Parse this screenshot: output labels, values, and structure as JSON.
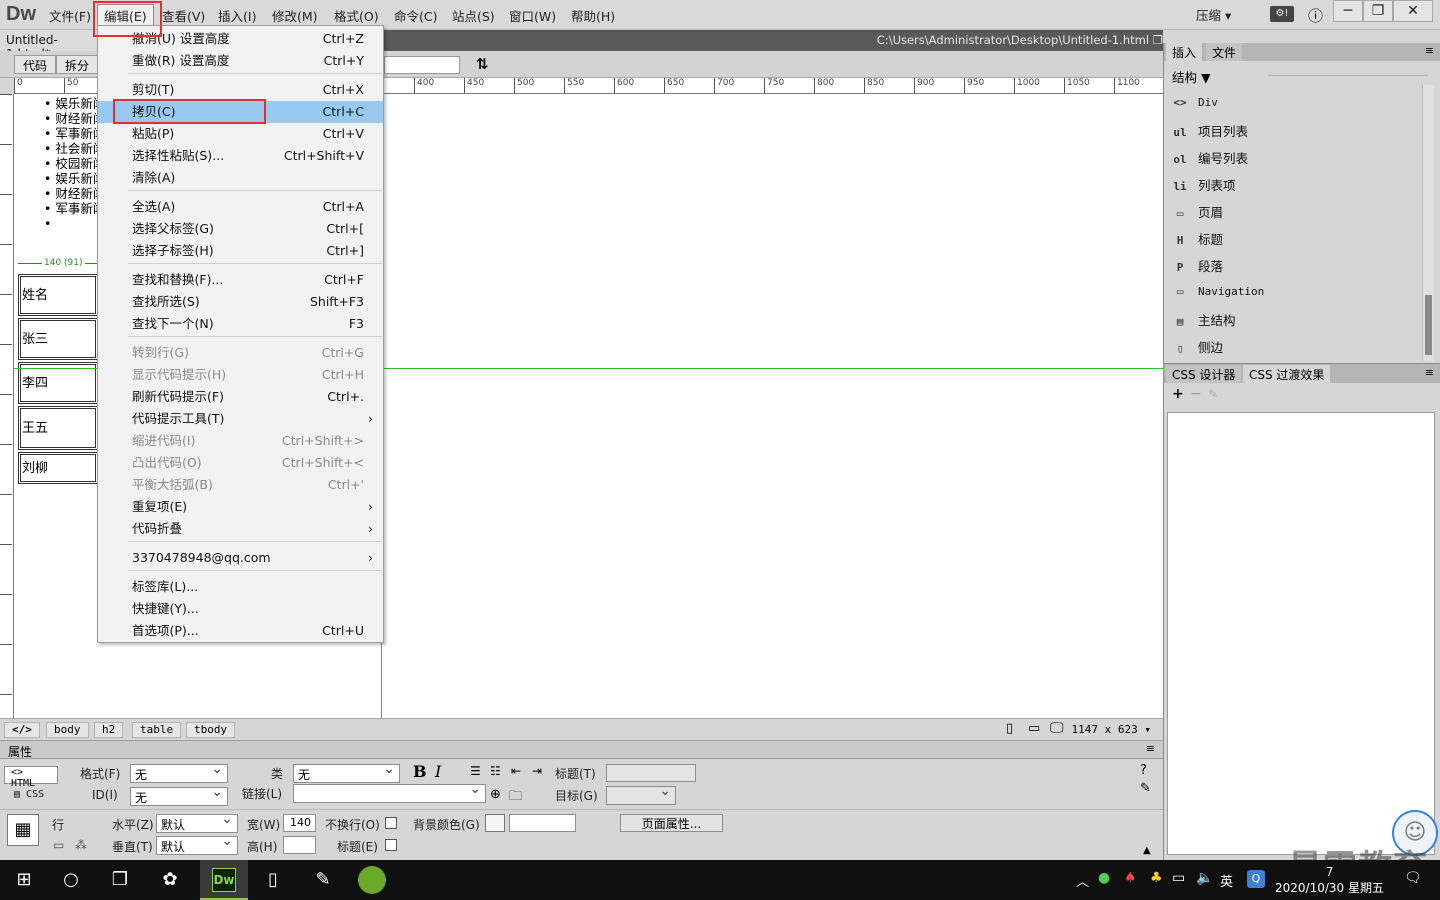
{
  "app": {
    "logo": "Dw",
    "doc_tab": "Untitled-1.html*",
    "doc_path": "C:\\Users\\Administrator\\Desktop\\Untitled-1.html",
    "compress": "压缩",
    "active_menu_color": "#e03030"
  },
  "menubar": {
    "items": [
      "文件(F)",
      "编辑(E)",
      "查看(V)",
      "插入(I)",
      "修改(M)",
      "格式(O)",
      "命令(C)",
      "站点(S)",
      "窗口(W)",
      "帮助(H)"
    ]
  },
  "toolbar": {
    "code": "代码",
    "split": "拆分"
  },
  "ruler": {
    "h": [
      "0",
      "50",
      "400",
      "450",
      "500",
      "550",
      "600",
      "650",
      "700",
      "750",
      "800",
      "850",
      "900",
      "950",
      "1000",
      "1050",
      "1100"
    ]
  },
  "content": {
    "news": [
      "娱乐新闻",
      "财经新闻",
      "军事新闻",
      "社会新闻",
      "校园新闻",
      "娱乐新闻",
      "财经新闻",
      "军事新闻",
      ""
    ],
    "table_width": "140 (91)",
    "cells": [
      "姓名",
      "张三",
      "李四",
      "王五",
      "刘柳"
    ]
  },
  "edit_menu": {
    "items": [
      {
        "label": "撤消(U) 设置高度",
        "shortcut": "Ctrl+Z"
      },
      {
        "label": "重做(R) 设置高度",
        "shortcut": "Ctrl+Y"
      },
      {
        "label": "剪切(T)",
        "shortcut": "Ctrl+X"
      },
      {
        "label": "拷贝(C)",
        "shortcut": "Ctrl+C",
        "selected": true
      },
      {
        "label": "粘贴(P)",
        "shortcut": "Ctrl+V"
      },
      {
        "label": "选择性粘贴(S)...",
        "shortcut": "Ctrl+Shift+V"
      },
      {
        "label": "清除(A)",
        "shortcut": ""
      },
      {
        "label": "全选(A)",
        "shortcut": "Ctrl+A"
      },
      {
        "label": "选择父标签(G)",
        "shortcut": "Ctrl+["
      },
      {
        "label": "选择子标签(H)",
        "shortcut": "Ctrl+]"
      },
      {
        "label": "查找和替换(F)...",
        "shortcut": "Ctrl+F"
      },
      {
        "label": "查找所选(S)",
        "shortcut": "Shift+F3"
      },
      {
        "label": "查找下一个(N)",
        "shortcut": "F3"
      },
      {
        "label": "转到行(G)",
        "shortcut": "Ctrl+G",
        "disabled": true
      },
      {
        "label": "显示代码提示(H)",
        "shortcut": "Ctrl+H",
        "disabled": true
      },
      {
        "label": "刷新代码提示(F)",
        "shortcut": "Ctrl+."
      },
      {
        "label": "代码提示工具(T)",
        "shortcut": "",
        "submenu": true
      },
      {
        "label": "缩进代码(I)",
        "shortcut": "Ctrl+Shift+>",
        "disabled": true
      },
      {
        "label": "凸出代码(O)",
        "shortcut": "Ctrl+Shift+<",
        "disabled": true
      },
      {
        "label": "平衡大括弧(B)",
        "shortcut": "Ctrl+'",
        "disabled": true
      },
      {
        "label": "重复项(E)",
        "shortcut": "",
        "submenu": true
      },
      {
        "label": "代码折叠",
        "shortcut": "",
        "submenu": true
      },
      {
        "label": "3370478948@qq.com",
        "shortcut": "",
        "submenu": true
      },
      {
        "label": "标签库(L)...",
        "shortcut": ""
      },
      {
        "label": "快捷键(Y)...",
        "shortcut": ""
      },
      {
        "label": "首选项(P)...",
        "shortcut": "Ctrl+U"
      }
    ]
  },
  "statusbar": {
    "tags": [
      "</>",
      "body",
      "h2",
      "table",
      "tbody"
    ],
    "size": "1147 x 623"
  },
  "properties": {
    "title": "属性",
    "html": "HTML",
    "css": "CSS",
    "format_label": "格式(F)",
    "format_value": "无",
    "class_label": "类",
    "class_value": "无",
    "id_label": "ID(I)",
    "id_value": "无",
    "link_label": "链接(L)",
    "title_label": "标题(T)",
    "target_label": "目标(G)",
    "row": "行",
    "horz_label": "水平(Z)",
    "horz_value": "默认",
    "vert_label": "垂直(T)",
    "vert_value": "默认",
    "width_label": "宽(W)",
    "width_value": "140",
    "height_label": "高(H)",
    "nowrap_label": "不换行(O)",
    "header_label": "标题(E)",
    "bg_label": "背景颜色(G)",
    "page_props": "页面属性..."
  },
  "right_panel": {
    "tab_insert": "插入",
    "tab_files": "文件",
    "category": "结构",
    "items": [
      {
        "icon": "<>",
        "label": "Div"
      },
      {
        "icon": "ul",
        "label": "项目列表"
      },
      {
        "icon": "ol",
        "label": "编号列表"
      },
      {
        "icon": "li",
        "label": "列表项"
      },
      {
        "icon": "▭",
        "label": "页眉"
      },
      {
        "icon": "H",
        "label": "标题"
      },
      {
        "icon": "P",
        "label": "段落"
      },
      {
        "icon": "▭",
        "label": "Navigation"
      },
      {
        "icon": "▤",
        "label": "主结构"
      },
      {
        "icon": "▯",
        "label": "侧边"
      }
    ],
    "css_designer": "CSS 设计器",
    "css_transitions": "CSS 过渡效果"
  },
  "taskbar": {
    "app_dw": "Dw",
    "ime": "英",
    "time": "7",
    "date": "2020/10/30 星期五"
  },
  "watermark": "最需教育"
}
